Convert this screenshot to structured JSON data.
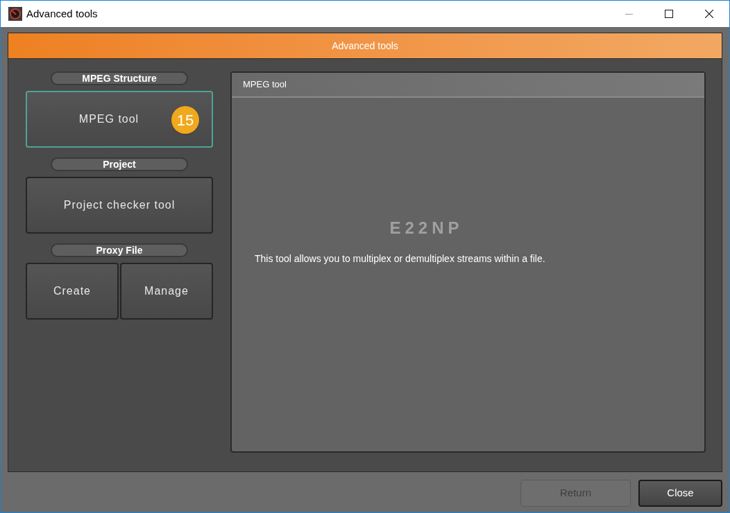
{
  "window": {
    "title": "Advanced tools"
  },
  "header": {
    "title": "Advanced tools"
  },
  "sections": [
    {
      "label": "MPEG Structure",
      "buttons": [
        {
          "label": "MPEG tool",
          "selected": true,
          "badge": "15"
        }
      ]
    },
    {
      "label": "Project",
      "buttons": [
        {
          "label": "Project checker tool",
          "selected": false
        }
      ]
    },
    {
      "label": "Proxy File",
      "buttons": [
        {
          "label": "Create",
          "selected": false
        },
        {
          "label": "Manage",
          "selected": false
        }
      ]
    }
  ],
  "panel": {
    "title": "MPEG tool",
    "code": "E22NP",
    "description": "This tool allows you to multiplex or demultiplex streams within a file."
  },
  "footer_buttons": [
    {
      "label": "Return",
      "disabled": true
    },
    {
      "label": "Close",
      "disabled": false
    }
  ]
}
